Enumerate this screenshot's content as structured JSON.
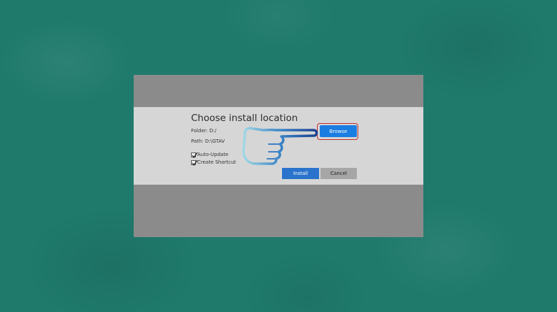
{
  "dialog": {
    "title": "Choose install location",
    "folder_label": "Folder:",
    "folder_value": "D:/",
    "path_label": "Path:",
    "path_value": "D:\\GTAV",
    "options": [
      {
        "label": "Auto-Update",
        "checked": true
      },
      {
        "label": "Create Shortcut",
        "checked": true
      }
    ],
    "browse_label": "Browse",
    "install_label": "Install",
    "cancel_label": "Cancel"
  },
  "colors": {
    "background": "#1f7a6c",
    "window": "#8b8b8b",
    "band": "#d6d6d6",
    "primary_button": "#1a7de2",
    "highlight_ring": "#c22a2a",
    "cancel_button": "#a6a6a6"
  },
  "icons": {
    "pointer": "pointing-hand-icon",
    "checkbox": "checkmark-icon"
  }
}
